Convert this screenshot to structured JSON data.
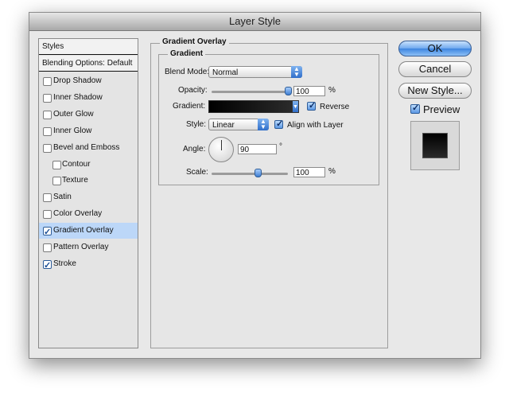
{
  "window": {
    "title": "Layer Style"
  },
  "styles_panel": {
    "header": "Styles",
    "blending_options": "Blending Options: Default",
    "items": [
      {
        "label": "Drop Shadow",
        "checked": false,
        "indent": false,
        "selected": false
      },
      {
        "label": "Inner Shadow",
        "checked": false,
        "indent": false,
        "selected": false
      },
      {
        "label": "Outer Glow",
        "checked": false,
        "indent": false,
        "selected": false
      },
      {
        "label": "Inner Glow",
        "checked": false,
        "indent": false,
        "selected": false
      },
      {
        "label": "Bevel and Emboss",
        "checked": false,
        "indent": false,
        "selected": false
      },
      {
        "label": "Contour",
        "checked": false,
        "indent": true,
        "selected": false
      },
      {
        "label": "Texture",
        "checked": false,
        "indent": true,
        "selected": false
      },
      {
        "label": "Satin",
        "checked": false,
        "indent": false,
        "selected": false
      },
      {
        "label": "Color Overlay",
        "checked": false,
        "indent": false,
        "selected": false
      },
      {
        "label": "Gradient Overlay",
        "checked": true,
        "indent": false,
        "selected": true
      },
      {
        "label": "Pattern Overlay",
        "checked": false,
        "indent": false,
        "selected": false
      },
      {
        "label": "Stroke",
        "checked": true,
        "indent": false,
        "selected": false
      }
    ]
  },
  "gradient_overlay": {
    "section_title": "Gradient Overlay",
    "group_title": "Gradient",
    "blend_mode_label": "Blend Mode:",
    "blend_mode_value": "Normal",
    "opacity_label": "Opacity:",
    "opacity_value": "100",
    "opacity_unit": "%",
    "opacity_fraction": 1.0,
    "gradient_label": "Gradient:",
    "reverse_label": "Reverse",
    "reverse_checked": true,
    "style_label": "Style:",
    "style_value": "Linear",
    "align_label": "Align with Layer",
    "align_checked": true,
    "angle_label": "Angle:",
    "angle_value": "90",
    "angle_unit": "°",
    "scale_label": "Scale:",
    "scale_value": "100",
    "scale_unit": "%",
    "scale_fraction": 0.6
  },
  "buttons": {
    "ok": "OK",
    "cancel": "Cancel",
    "new_style": "New Style..."
  },
  "preview": {
    "label": "Preview",
    "checked": true
  },
  "colors": {
    "accent": "#3d85e0",
    "selection": "#bcd7f8"
  }
}
